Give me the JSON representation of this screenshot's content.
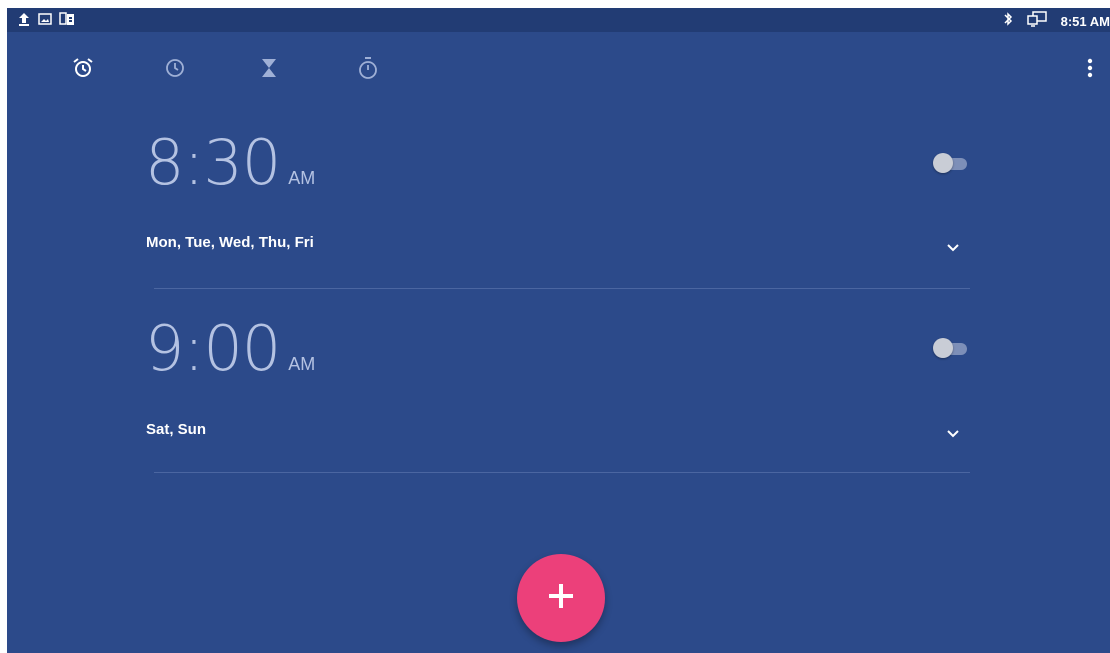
{
  "status_bar": {
    "left_icons": [
      "upload-icon",
      "image-icon",
      "sim-card-icon"
    ],
    "right_icons": [
      "bluetooth-icon",
      "screen-cast-icon"
    ],
    "time": "8:51 AM"
  },
  "tabs": [
    {
      "name": "alarm",
      "icon": "alarm-icon",
      "selected": true
    },
    {
      "name": "clock",
      "icon": "clock-icon",
      "selected": false
    },
    {
      "name": "timer",
      "icon": "hourglass-icon",
      "selected": false
    },
    {
      "name": "stopwatch",
      "icon": "stopwatch-icon",
      "selected": false
    }
  ],
  "alarms": [
    {
      "time": "8:30",
      "ampm": "AM",
      "days": "Mon, Tue, Wed, Thu, Fri",
      "enabled": false
    },
    {
      "time": "9:00",
      "ampm": "AM",
      "days": "Sat, Sun",
      "enabled": false
    }
  ],
  "fab": {
    "icon": "plus-icon"
  },
  "colors": {
    "background": "#2c4a8a",
    "status_bar": "#223c74",
    "accent": "#ec407a"
  }
}
